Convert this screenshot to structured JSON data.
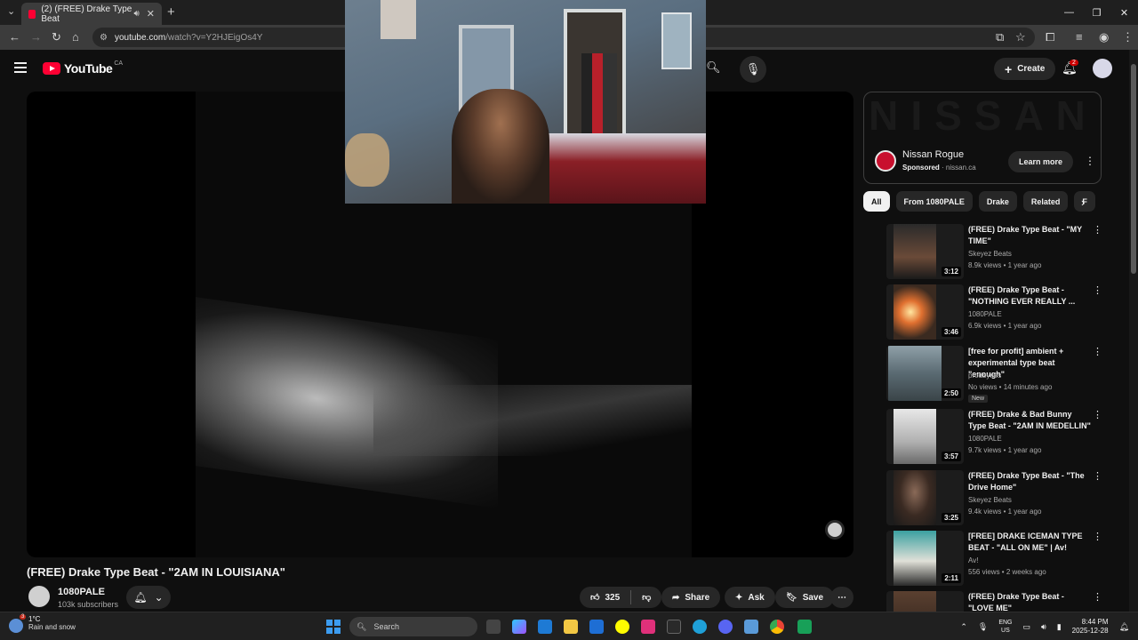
{
  "browser": {
    "tab_title": "(2) (FREE) Drake Type Beat",
    "tab_audio_icon": "speaker-icon",
    "new_tab": "+",
    "url_host": "youtube.com",
    "url_path": "/watch?v=Y2HJEigOs4Y",
    "window": {
      "minimize": "—",
      "maximize": "❐",
      "close": "✕"
    }
  },
  "youtube": {
    "logo_text": "YouTube",
    "region": "CA",
    "create_label": "Create",
    "notifications_count": "2"
  },
  "video": {
    "title": "(FREE) Drake Type Beat - \"2AM IN LOUISIANA\"",
    "channel": "1080PALE",
    "subscribers": "103k subscribers",
    "likes": "325",
    "share_label": "Share",
    "ask_label": "Ask",
    "save_label": "Save",
    "more_label": "⋯"
  },
  "ad": {
    "banner_text": "NISSAN",
    "title": "Nissan Rogue",
    "sponsored": "Sponsored",
    "domain": "nissan.ca",
    "cta": "Learn more"
  },
  "chips": [
    "All",
    "From 1080PALE",
    "Drake",
    "Related",
    "F"
  ],
  "recommendations": [
    {
      "title": "(FREE) Drake Type Beat - \"MY TIME\"",
      "channel": "Skeyez Beats",
      "meta": "8.9k views • 1 year ago",
      "duration": "3:12",
      "badge": ""
    },
    {
      "title": "(FREE) Drake Type Beat - \"NOTHING EVER REALLY ...",
      "channel": "1080PALE",
      "meta": "6.9k views • 1 year ago",
      "duration": "3:46",
      "badge": ""
    },
    {
      "title": "[free for profit] ambient + experimental type beat \"enough\"",
      "channel": "prodbyries",
      "meta": "No views • 14 minutes ago",
      "duration": "2:50",
      "badge": "New"
    },
    {
      "title": "(FREE) Drake & Bad Bunny Type Beat - \"2AM IN MEDELLIN\"",
      "channel": "1080PALE",
      "meta": "9.7k views • 1 year ago",
      "duration": "3:57",
      "badge": ""
    },
    {
      "title": "(FREE) Drake Type Beat - \"The Drive Home\"",
      "channel": "Skeyez Beats",
      "meta": "9.4k views • 1 year ago",
      "duration": "3:25",
      "badge": ""
    },
    {
      "title": "[FREE] DRAKE ICEMAN TYPE BEAT - \"ALL ON ME\" | Av!",
      "channel": "Av!",
      "meta": "556 views • 2 weeks ago",
      "duration": "2:11",
      "badge": ""
    },
    {
      "title": "(FREE) Drake Type Beat - \"LOVE ME\"",
      "channel": "",
      "meta": "",
      "duration": "",
      "badge": ""
    }
  ],
  "taskbar": {
    "weather_temp": "1°C",
    "weather_cond": "Rain and snow",
    "weather_badge": "3",
    "search_placeholder": "Search",
    "lang_top": "ENG",
    "lang_bottom": "US",
    "time": "8:44 PM",
    "date": "2025-12-28"
  },
  "colors": {
    "accent": "#ff0033",
    "background": "#0f0f0f",
    "surface": "#272727"
  }
}
